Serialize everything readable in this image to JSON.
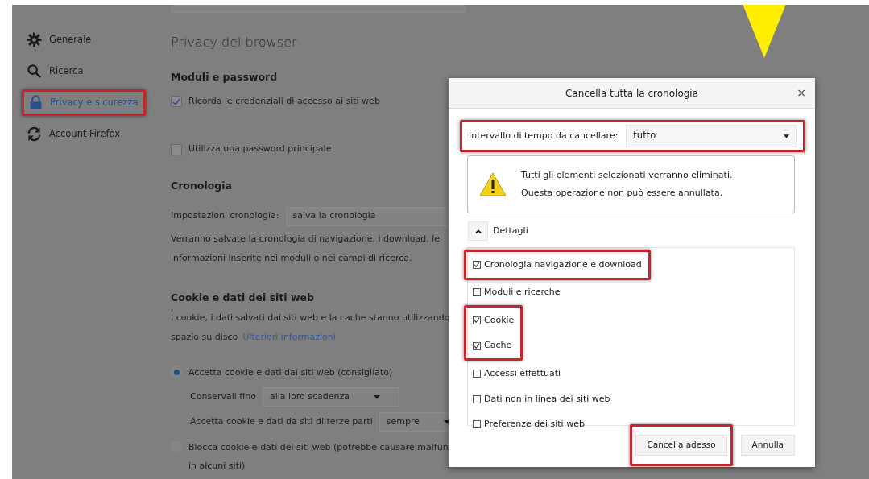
{
  "sidebar": {
    "items": [
      {
        "label": "Generale",
        "selected": false,
        "highlighted": false
      },
      {
        "label": "Ricerca",
        "selected": false,
        "highlighted": false
      },
      {
        "label": "Privacy e sicurezza",
        "selected": true,
        "highlighted": true
      },
      {
        "label": "Account Firefox",
        "selected": false,
        "highlighted": false
      }
    ]
  },
  "content": {
    "title": "Privacy del browser",
    "blocks": [
      {
        "kind": "heading",
        "text": "Moduli e password"
      },
      {
        "kind": "checkbox",
        "label": "Ricorda le credenziali di accesso ai siti web",
        "checked": true
      },
      {
        "kind": "checkbox",
        "label": "Utilizza una password principale",
        "checked": false
      },
      {
        "kind": "heading",
        "text": "Cronologia"
      },
      {
        "kind": "select",
        "label": "Impostazioni cronologia:",
        "value": "salva la cronologia"
      },
      {
        "kind": "paragraph",
        "lines": [
          "Verranno salvate la cronologia di navigazione, i download, le",
          "informazioni inserite nei moduli o nei campi di ricerca."
        ]
      },
      {
        "kind": "heading",
        "text": "Cookie e dati dei siti web"
      },
      {
        "kind": "paragraph",
        "lines": [
          "I cookie, i dati salvati dai siti web e la cache stanno utilizzando",
          "spazio su disco"
        ],
        "link": "Ulteriori informazioni"
      },
      {
        "kind": "radio",
        "lines": [
          "Accetta cookie e dati dai siti web (consigliato)"
        ],
        "selected": true
      },
      {
        "kind": "subselect",
        "label": "Conservali fino",
        "value": "alla loro scadenza"
      },
      {
        "kind": "subselect",
        "label": "Accetta cookie e dati da siti di terze parti",
        "value": "sempre"
      },
      {
        "kind": "radio",
        "lines": [
          "Blocca cookie e dati dei siti web (potrebbe causare malfun",
          "in alcuni siti)"
        ],
        "selected": false
      }
    ]
  },
  "dialog": {
    "title": "Cancella tutta la cronologia",
    "close": "×",
    "range": {
      "label": "Intervallo di tempo da cancellare:",
      "value": "tutto",
      "highlighted": true
    },
    "warning": [
      "Tutti gli elementi selezionati verranno eliminati.",
      "Questa operazione non può essere annullata."
    ],
    "details": {
      "label": "Dettagli",
      "expanded": true
    },
    "items": [
      {
        "label": "Cronologia navigazione e download",
        "checked": true,
        "highlighted": true
      },
      {
        "label": "Moduli e ricerche",
        "checked": false,
        "highlighted": false
      },
      {
        "label": "Cookie",
        "checked": true,
        "highlighted": true
      },
      {
        "label": "Cache",
        "checked": true,
        "highlighted": true
      },
      {
        "label": "Accessi effettuati",
        "checked": false,
        "highlighted": false
      },
      {
        "label": "Dati non in linea dei siti web",
        "checked": false,
        "highlighted": false
      },
      {
        "label": "Preferenze dei siti web",
        "checked": false,
        "highlighted": false
      }
    ],
    "buttons": [
      {
        "label": "Cancella adesso",
        "highlighted": true
      },
      {
        "label": "Annulla",
        "highlighted": false
      }
    ]
  }
}
